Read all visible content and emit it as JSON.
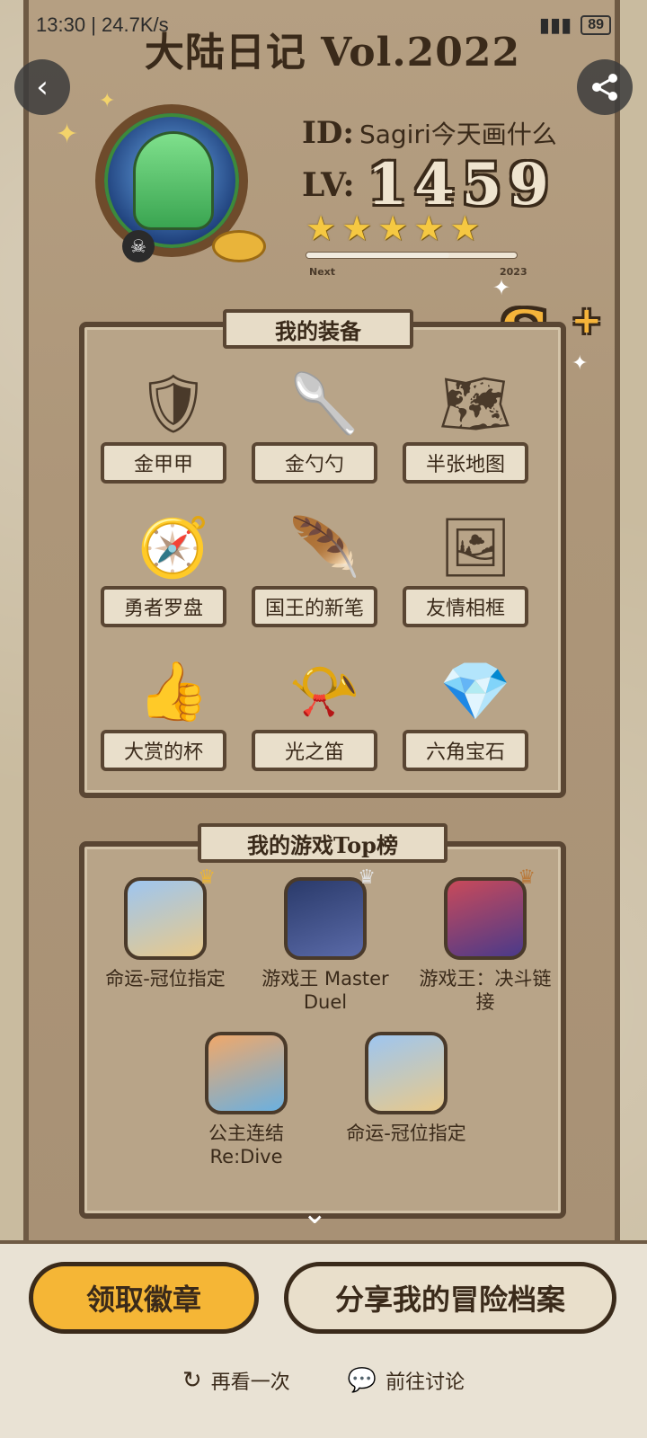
{
  "status_bar": {
    "time": "13:30",
    "speed": "24.7K/s",
    "battery": "89"
  },
  "banner": {
    "title": "大陆日记 Vol.2022"
  },
  "profile": {
    "id_label": "ID:",
    "name": "Sagiri今天画什么",
    "lv_label": "LV:",
    "level": "1459",
    "stars": 5,
    "progress_next": "Next",
    "progress_year": "2023",
    "rank": "S",
    "rank_plus": "+"
  },
  "equipment": {
    "title": "我的装备",
    "items": [
      {
        "label": "金甲甲",
        "icon": "armor-icon"
      },
      {
        "label": "金勺勺",
        "icon": "spoon-icon"
      },
      {
        "label": "半张地图",
        "icon": "map-icon"
      },
      {
        "label": "勇者罗盘",
        "icon": "compass-icon"
      },
      {
        "label": "国王的新笔",
        "icon": "pen-icon"
      },
      {
        "label": "友情相框",
        "icon": "frame-icon"
      },
      {
        "label": "大赏的杯",
        "icon": "trophy-icon"
      },
      {
        "label": "光之笛",
        "icon": "whistle-icon"
      },
      {
        "label": "六角宝石",
        "icon": "gem-icon"
      }
    ]
  },
  "top_games": {
    "title": "我的游戏Top榜",
    "items": [
      {
        "name": "命运-冠位指定",
        "crown": "gold"
      },
      {
        "name": "游戏王 Master Duel",
        "crown": "silver"
      },
      {
        "name": "游戏王：决斗链接",
        "crown": "bronze"
      },
      {
        "name": "公主连结Re:Dive",
        "crown": ""
      },
      {
        "name": "命运-冠位指定",
        "crown": ""
      }
    ]
  },
  "actions": {
    "claim_badge": "领取徽章",
    "share_profile": "分享我的冒险档案",
    "replay": "再看一次",
    "discuss": "前往讨论"
  },
  "colors": {
    "accent": "#f5b636",
    "frame": "#5a4633",
    "paper": "#e9dfcb"
  }
}
